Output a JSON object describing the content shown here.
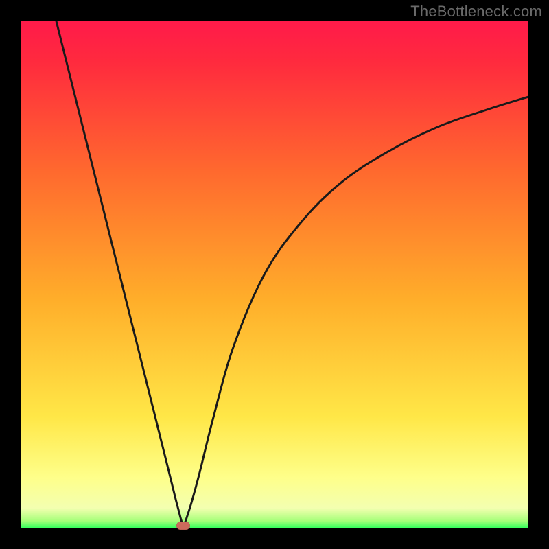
{
  "watermark": "TheBottleneck.com",
  "colors": {
    "gradient": {
      "c0": "#ff1a4a",
      "c1": "#ff2a3e",
      "c2": "#ff6a2e",
      "c3": "#ffae2a",
      "c4": "#ffe747",
      "c5": "#feff8a",
      "c6": "#f3ffb0",
      "c7": "#a7ff7a",
      "c8": "#2dff5a"
    },
    "curve_stroke": "#1a1a1a",
    "marker_fill": "#cc6a5c"
  },
  "chart_data": {
    "type": "line",
    "title": "",
    "xlabel": "",
    "ylabel": "",
    "xlim": [
      0,
      100
    ],
    "ylim": [
      0,
      100
    ],
    "notch_x": 32,
    "marker": {
      "x": 32,
      "y": 0.5
    },
    "series": [
      {
        "name": "left-branch",
        "x": [
          7,
          10,
          14,
          18,
          22,
          26,
          29,
          31,
          32
        ],
        "y": [
          100,
          88,
          72,
          56,
          40,
          24,
          12,
          4,
          1
        ]
      },
      {
        "name": "right-branch",
        "x": [
          32,
          33,
          35,
          38,
          42,
          48,
          55,
          63,
          72,
          82,
          92,
          100
        ],
        "y": [
          1,
          3,
          10,
          22,
          36,
          50,
          60,
          68,
          74,
          79,
          82.5,
          85
        ]
      }
    ]
  }
}
